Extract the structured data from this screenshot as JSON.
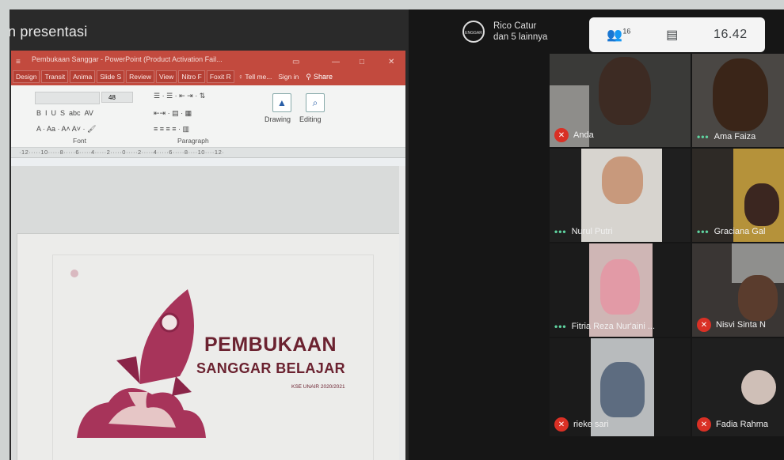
{
  "presentation": {
    "header": "n presentasi"
  },
  "ppt": {
    "window_title": "Pembukaan Sanggar - PowerPoint (Product Activation Fail...",
    "tabs": [
      "Design",
      "Transit",
      "Anima",
      "Slide S",
      "Review",
      "View",
      "Nitro F",
      "Foxit R"
    ],
    "tell_me": "Tell me...",
    "sign_in": "Sign in",
    "share": "Share",
    "font_group": "Font",
    "paragraph_group": "Paragraph",
    "font_size": "48",
    "drawing": "Drawing",
    "editing": "Editing",
    "ruler": "·12·····10·····8·····6·····4·····2·····0·····2·····4·····6·····8····10····12·"
  },
  "slide": {
    "title": "PEMBUKAAN",
    "subtitle": "SANGGAR BELAJAR",
    "small": "KSE UNAIR 2020/2021"
  },
  "meet": {
    "host_avatar": "ENGGAR",
    "host_name": "Rico Catur",
    "host_more": "dan 5 lainnya",
    "people_count": "16",
    "time": "16.42",
    "participants": [
      {
        "name": "Anda",
        "state": "muted"
      },
      {
        "name": "Ama Faiza",
        "state": "speaking"
      },
      {
        "name": "Nurul Putri",
        "state": "speaking"
      },
      {
        "name": "Graciana Gal",
        "state": "speaking"
      },
      {
        "name": "Fitria Reza Nur'aini ...",
        "state": "speaking"
      },
      {
        "name": "Nisvi Sinta N",
        "state": "muted"
      },
      {
        "name": "rieke sari",
        "state": "muted"
      },
      {
        "name": "Fadia Rahma",
        "state": "muted"
      }
    ]
  },
  "colors": {
    "ppt_red": "#c24a3e",
    "mic_off": "#d93025",
    "slide_text": "#6b2230"
  }
}
